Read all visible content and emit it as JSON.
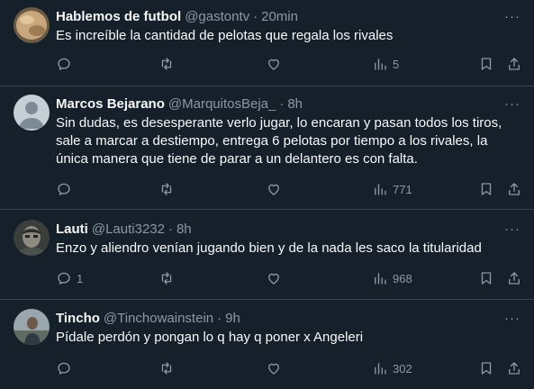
{
  "tweets": [
    {
      "name": "Hablemos de futbol",
      "handle": "@gastontv",
      "dot": "·",
      "time": "20min",
      "text": "Es increíble la cantidad de pelotas que regala los rivales",
      "replies": "",
      "retweets": "",
      "likes": "",
      "views": "5"
    },
    {
      "name": "Marcos Bejarano",
      "handle": "@MarquitosBeja_",
      "dot": "·",
      "time": "8h",
      "text": "Sin dudas, es desesperante verlo jugar, lo encaran y pasan todos los tiros, sale a marcar a destiempo, entrega 6 pelotas por tiempo a los rivales, la única manera que tiene de parar a un delantero es con falta.",
      "replies": "",
      "retweets": "",
      "likes": "",
      "views": "771"
    },
    {
      "name": "Lauti",
      "handle": "@Lauti3232",
      "dot": "·",
      "time": "8h",
      "text": "Enzo y aliendro venían jugando bien y de la nada les saco la titularidad",
      "replies": "1",
      "retweets": "",
      "likes": "",
      "views": "968"
    },
    {
      "name": "Tincho",
      "handle": "@Tinchowainstein",
      "dot": "·",
      "time": "9h",
      "text": "Pídale perdón y pongan lo q hay q poner x Angeleri",
      "replies": "",
      "retweets": "",
      "likes": "",
      "views": "302"
    }
  ],
  "colors": {
    "background": "#15202b",
    "text_primary": "#f7f9f9",
    "text_secondary": "#8b98a5",
    "divider": "#38444d"
  },
  "icons": [
    "more-icon",
    "reply-icon",
    "retweet-icon",
    "like-icon",
    "views-icon",
    "bookmark-icon",
    "share-icon"
  ]
}
